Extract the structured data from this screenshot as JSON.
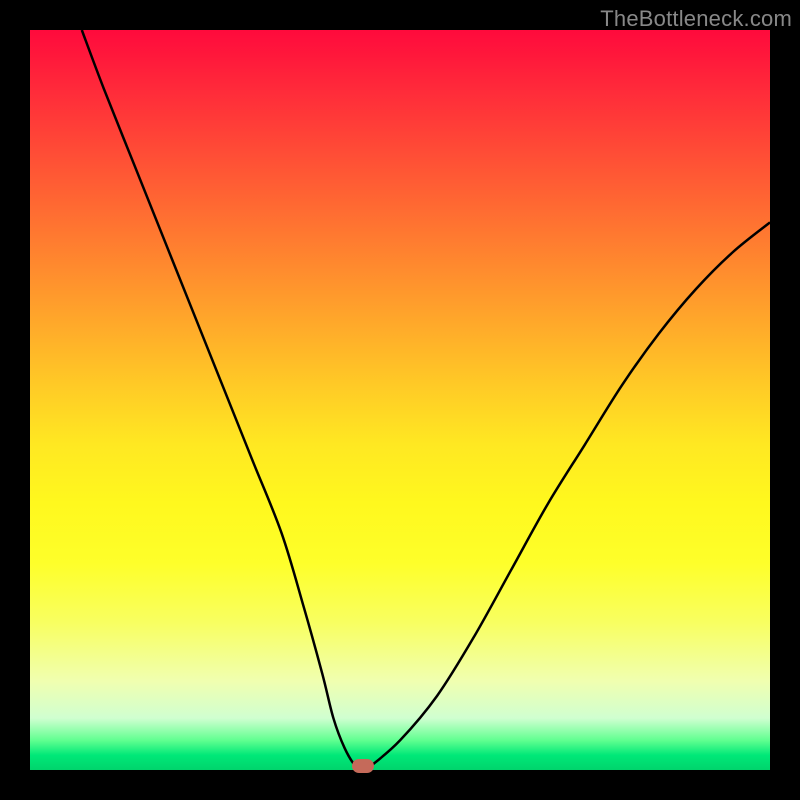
{
  "watermark": "TheBottleneck.com",
  "chart_data": {
    "type": "line",
    "title": "",
    "xlabel": "",
    "ylabel": "",
    "xlim": [
      0,
      100
    ],
    "ylim": [
      0,
      100
    ],
    "grid": false,
    "legend": false,
    "series": [
      {
        "name": "bottleneck-curve",
        "x": [
          7,
          10,
          14,
          18,
          22,
          26,
          30,
          34,
          37,
          39.5,
          41,
          42.5,
          44,
          45,
          46,
          50,
          55,
          60,
          65,
          70,
          75,
          80,
          85,
          90,
          95,
          100
        ],
        "y": [
          100,
          92,
          82,
          72,
          62,
          52,
          42,
          32,
          22,
          13,
          7,
          3,
          0.5,
          0,
          0.5,
          4,
          10,
          18,
          27,
          36,
          44,
          52,
          59,
          65,
          70,
          74
        ]
      }
    ],
    "marker": {
      "x": 45,
      "y": 0.5,
      "color": "#c56a5a"
    },
    "background_gradient": {
      "top": "#ff0a3c",
      "mid": "#ffe822",
      "bottom": "#00d46c"
    }
  }
}
